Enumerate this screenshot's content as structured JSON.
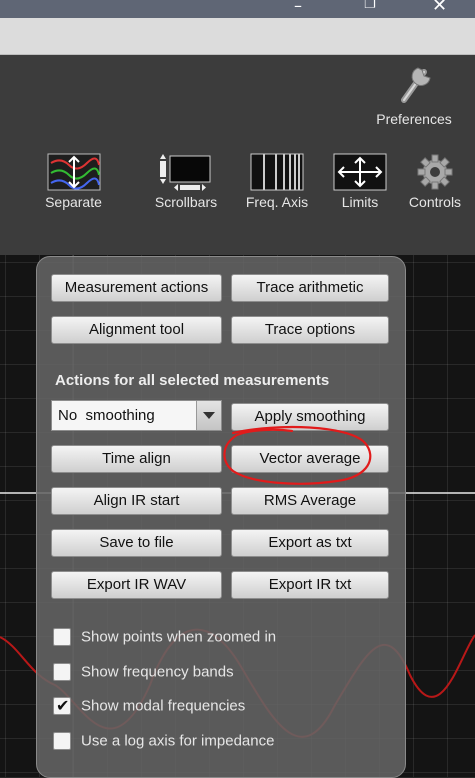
{
  "toolbar": {
    "preferences_label": "Preferences",
    "items": [
      {
        "label": "Separate",
        "icon": "separate-icon"
      },
      {
        "label": "Scrollbars",
        "icon": "scrollbars-icon"
      },
      {
        "label": "Freq. Axis",
        "icon": "freq-axis-icon"
      },
      {
        "label": "Limits",
        "icon": "limits-icon"
      },
      {
        "label": "Controls",
        "icon": "gear-icon"
      }
    ]
  },
  "panel": {
    "top_buttons": [
      "Measurement actions",
      "Trace arithmetic",
      "Alignment tool",
      "Trace options"
    ],
    "section_title": "Actions for all selected measurements",
    "smoothing_select": "No  smoothing",
    "buttons": [
      "Apply smoothing",
      "Time align",
      "Vector average",
      "Align IR start",
      "RMS Average",
      "Save to file",
      "Export as txt",
      "Export IR WAV",
      "Export IR txt"
    ],
    "checkboxes": [
      {
        "label": "Show points when zoomed in",
        "checked": false
      },
      {
        "label": "Show frequency bands",
        "checked": false
      },
      {
        "label": "Show modal frequencies",
        "checked": true
      },
      {
        "label": "Use a log axis for impedance",
        "checked": false
      }
    ]
  },
  "colors": {
    "annotation": "#e11b1b",
    "trace": "#b81818",
    "panel_bg": "#646464"
  }
}
